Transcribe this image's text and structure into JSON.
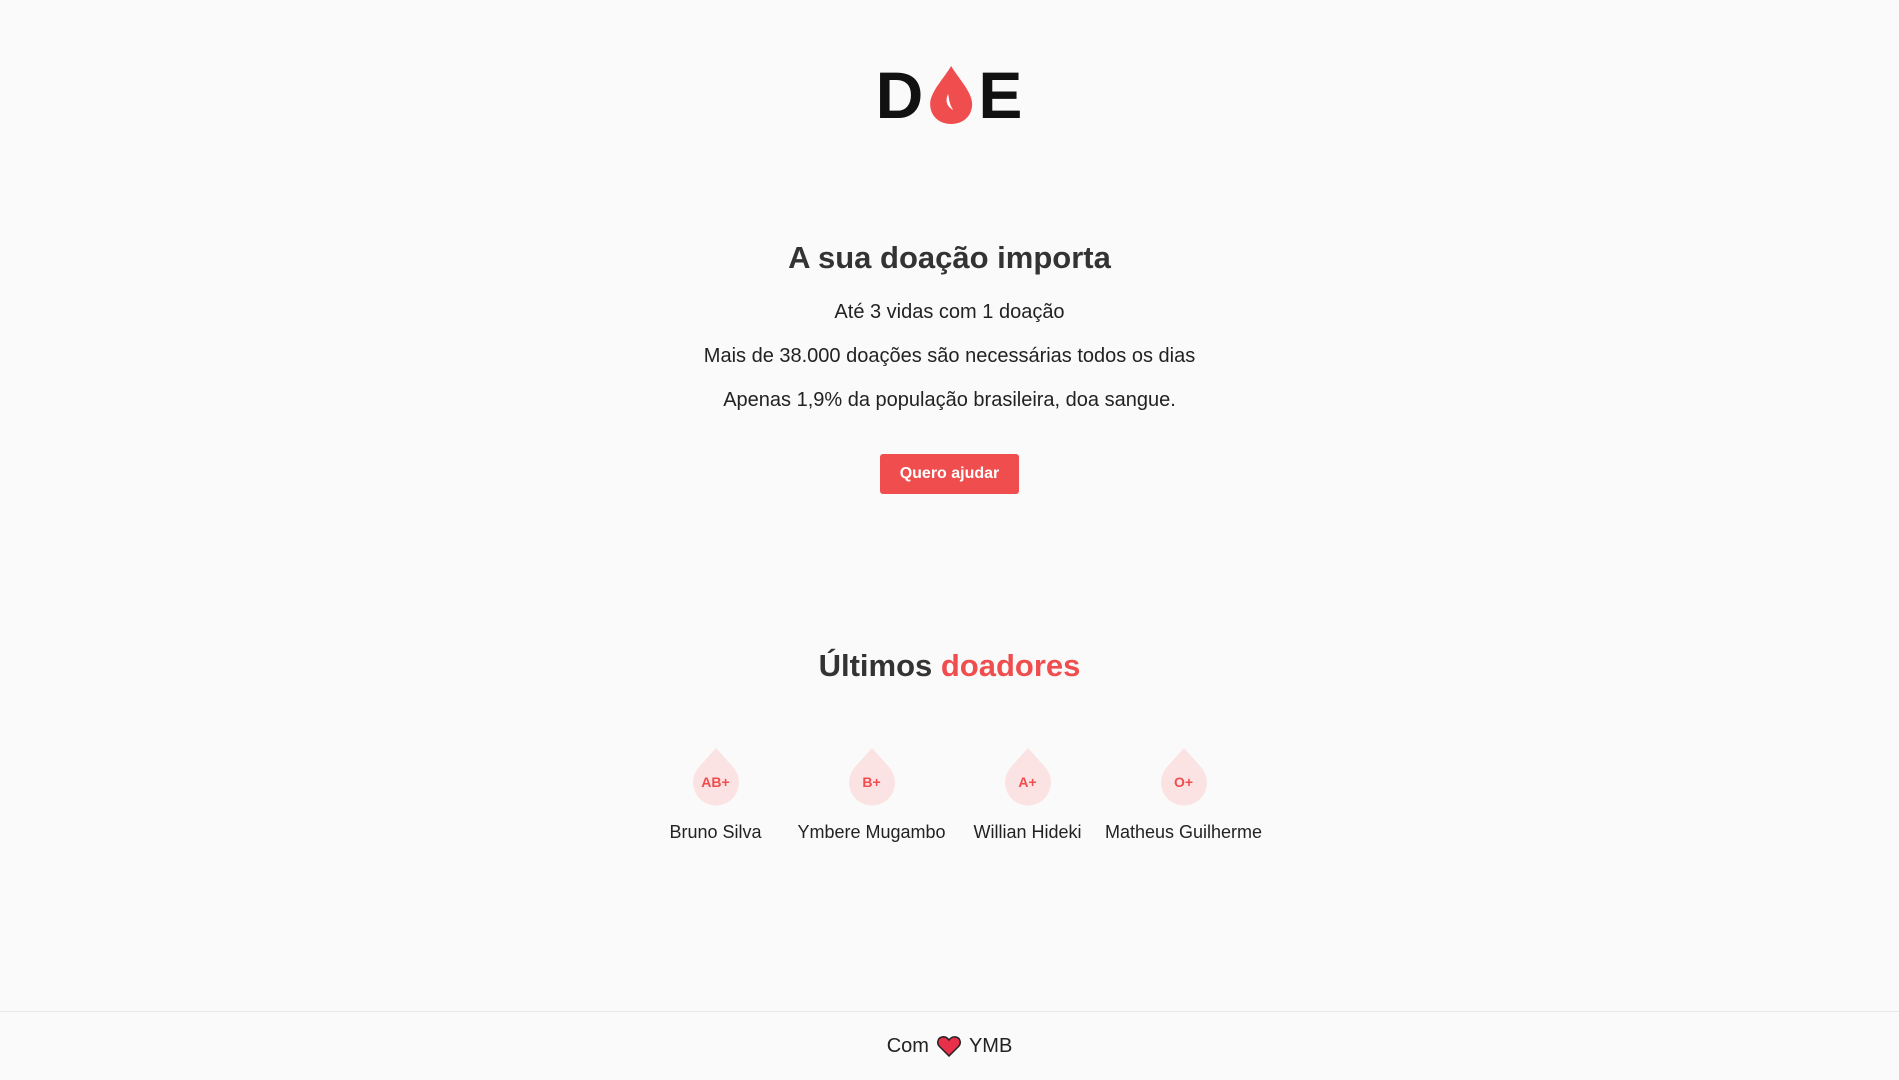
{
  "logo": {
    "left": "D",
    "right": "E"
  },
  "hero": {
    "title": "A sua doação importa",
    "lines": [
      "Até 3 vidas com 1 doação",
      "Mais de 38.000 doações são necessárias todos os dias",
      "Apenas 1,9% da população brasileira, doa sangue."
    ],
    "cta_label": "Quero ajudar"
  },
  "donors": {
    "title_plain": "Últimos ",
    "title_accent": "doadores",
    "items": [
      {
        "blood_type": "AB+",
        "name": "Bruno Silva"
      },
      {
        "blood_type": "B+",
        "name": "Ymbere Mugambo"
      },
      {
        "blood_type": "A+",
        "name": "Willian Hideki"
      },
      {
        "blood_type": "O+",
        "name": "Matheus Guilherme"
      }
    ]
  },
  "footer": {
    "prefix": "Com",
    "suffix": "YMB",
    "icon": "heart-icon"
  },
  "colors": {
    "accent": "#f04e4e",
    "badge_bg": "#fbe3e3",
    "background": "#fafafa"
  }
}
